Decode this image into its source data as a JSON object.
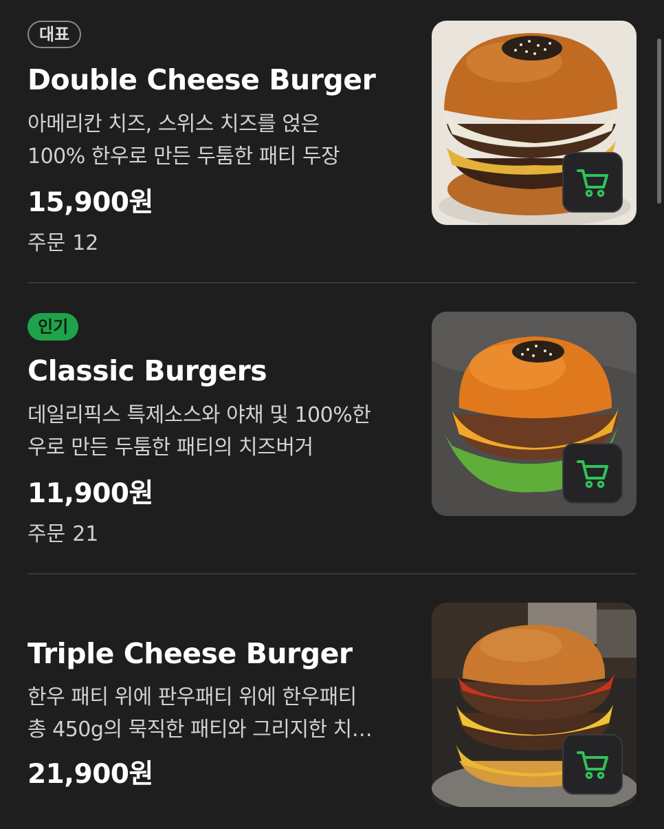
{
  "menu": {
    "items": [
      {
        "badge": "대표",
        "name": "Double Cheese Burger",
        "description_lines": [
          "아메리칸 치즈, 스위스 치즈를 얹은",
          "100% 한우로 만든 두툼한 패티 두장"
        ],
        "price": "15,900원",
        "orders_label": "주문",
        "orders_count": "12",
        "image": "double-cheese-burger-photo"
      },
      {
        "badge": "인기",
        "name": "Classic Burgers",
        "description_lines": [
          "데일리픽스 특제소스와 야채 및 100%한",
          "우로 만든 두툼한 패티의 치즈버거"
        ],
        "price": "11,900원",
        "orders_label": "주문",
        "orders_count": "21",
        "image": "classic-burger-photo"
      },
      {
        "badge": "",
        "name": "Triple Cheese Burger",
        "description_lines": [
          "한우 패티 위에 판우패티 위에 한우패티",
          "총 450g의 묵직한 패티와 그리지한 치…"
        ],
        "price": "21,900원",
        "image": "triple-cheese-burger-photo"
      }
    ],
    "cart_icon": "cart-icon"
  },
  "colors": {
    "background": "#1e1e1f",
    "accent_green": "#1fa34a",
    "cart_icon_green": "#2fc35a",
    "divider": "#3a3a3c"
  }
}
